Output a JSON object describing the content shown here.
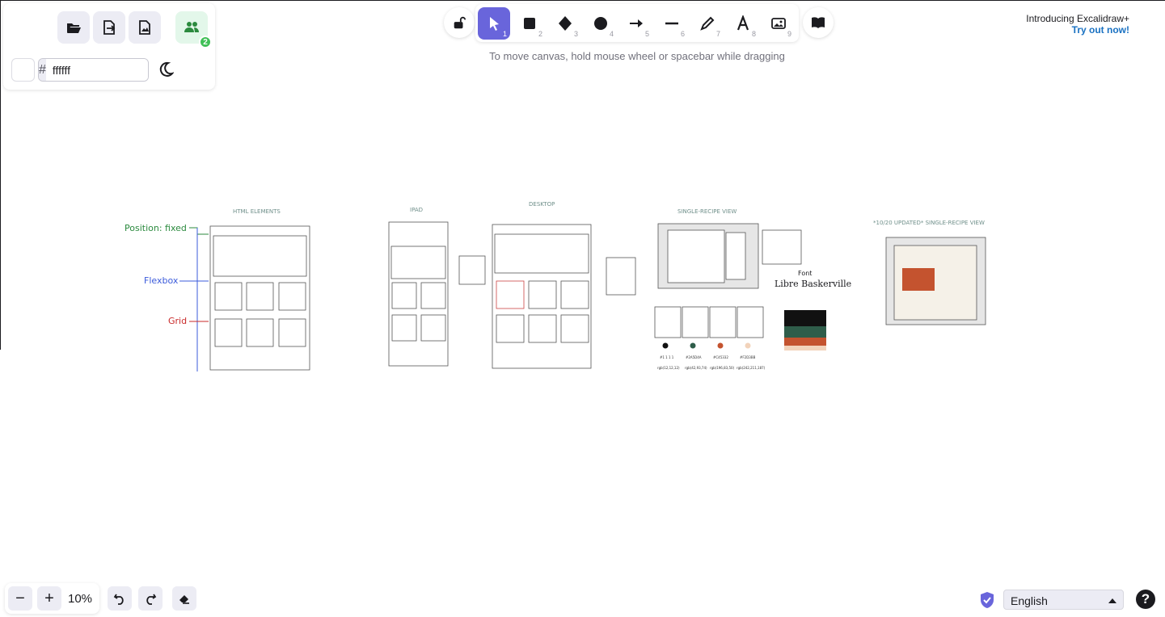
{
  "menu": {
    "open_icon": "folder-open-icon",
    "export_icon": "export-icon",
    "export_image_icon": "export-image-icon",
    "collab_icon": "users-icon",
    "collab_count": "2"
  },
  "canvas_bg": {
    "hash": "#",
    "value": "ffffff",
    "swatch_color": "#ffffff"
  },
  "toolbar": {
    "tools": [
      {
        "name": "selection",
        "num": "1"
      },
      {
        "name": "rectangle",
        "num": "2"
      },
      {
        "name": "diamond",
        "num": "3"
      },
      {
        "name": "ellipse",
        "num": "4"
      },
      {
        "name": "arrow",
        "num": "5"
      },
      {
        "name": "line",
        "num": "6"
      },
      {
        "name": "draw",
        "num": "7"
      },
      {
        "name": "text",
        "num": "8"
      },
      {
        "name": "image",
        "num": "9"
      }
    ],
    "accent": "#6965db",
    "hint": "To move canvas, hold mouse wheel or spacebar while dragging"
  },
  "promo": {
    "title": "Introducing Excalidraw+",
    "link": "Try out now!"
  },
  "drawing": {
    "label_fixed": "Position: fixed",
    "label_flexbox": "Flexbox",
    "label_grid": "Grid",
    "title_html": "HTML ELEMENTS",
    "title_ipad": "IPAD",
    "title_desktop": "DESKTOP",
    "title_single": "SINGLE-RECIPE VIEW",
    "title_updated": "*10/20 UPDATED* SINGLE-RECIPE VIEW",
    "font_label": "Font",
    "font_name": "Libre Baskerville",
    "palette_hex": [
      "#121212",
      "#2F5D4A",
      "#C4532F",
      "#F2D3BB"
    ],
    "palette_labels": [
      "#1 1 1 1",
      "#2A5D4A",
      "#C45332",
      "#F2D3BB"
    ],
    "palette_rgb": [
      "rgb(12,12,12)",
      "rgb(42,93,74)",
      "rgb(196,83,50)",
      "rgb(242,211,187)"
    ]
  },
  "zoom": {
    "minus": "−",
    "plus": "+",
    "level": "10%"
  },
  "language": {
    "selected": "English"
  },
  "help": "?"
}
